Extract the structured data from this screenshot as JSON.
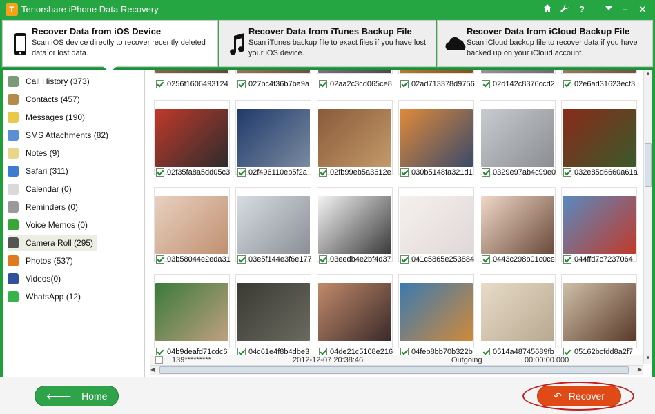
{
  "app": {
    "title": "Tenorshare iPhone Data Recovery",
    "logo_letter": "T"
  },
  "titlebar_buttons": [
    "home-icon",
    "wrench-icon",
    "help-icon",
    "dropdown-icon",
    "minimize-icon",
    "close-icon"
  ],
  "modes": [
    {
      "title": "Recover Data from iOS Device",
      "desc": "Scan iOS device directly to recover recently deleted data or lost data.",
      "icon": "phone-icon",
      "active": true
    },
    {
      "title": "Recover Data from iTunes Backup File",
      "desc": "Scan iTunes backup file to exact files if you have lost your iOS device.",
      "icon": "music-note-icon",
      "active": false
    },
    {
      "title": "Recover Data from iCloud Backup File",
      "desc": "Scan iCloud backup file to recover data if you have backed up on your iCloud account.",
      "icon": "cloud-icon",
      "active": false
    }
  ],
  "sidebar": {
    "items": [
      {
        "label": "Call History (373)",
        "icon": "call-history-icon",
        "color": "#7a9a7a"
      },
      {
        "label": "Contacts (457)",
        "icon": "contacts-icon",
        "color": "#b58a4a"
      },
      {
        "label": "Messages (190)",
        "icon": "messages-icon",
        "color": "#e9c94b"
      },
      {
        "label": "SMS Attachments (82)",
        "icon": "sms-attachments-icon",
        "color": "#5a8fd6"
      },
      {
        "label": "Notes (9)",
        "icon": "notes-icon",
        "color": "#e8d68a"
      },
      {
        "label": "Safari (311)",
        "icon": "safari-icon",
        "color": "#3b7bd1"
      },
      {
        "label": "Calendar (0)",
        "icon": "calendar-icon",
        "color": "#d9d9d9"
      },
      {
        "label": "Reminders (0)",
        "icon": "reminders-icon",
        "color": "#9a9a9a"
      },
      {
        "label": "Voice Memos (0)",
        "icon": "voice-memos-icon",
        "color": "#3aa63a"
      },
      {
        "label": "Camera Roll (295)",
        "icon": "camera-roll-icon",
        "color": "#555555",
        "active": true
      },
      {
        "label": "Photos (537)",
        "icon": "photos-icon",
        "color": "#e07a20"
      },
      {
        "label": "Videos(0)",
        "icon": "videos-icon",
        "color": "#3050a0"
      },
      {
        "label": "WhatsApp (12)",
        "icon": "whatsapp-icon",
        "color": "#36b34a"
      }
    ]
  },
  "gallery": {
    "rows": [
      [
        {
          "name": "0256f1606493124",
          "colors": [
            "#8a6a4a",
            "#5a4a3a"
          ]
        },
        {
          "name": "027bc4f36b7ba9a",
          "colors": [
            "#9a7a5a",
            "#6a5040"
          ]
        },
        {
          "name": "02aa2c3cd065ce8",
          "colors": [
            "#7a7a7a",
            "#4a4a4a"
          ]
        },
        {
          "name": "02ad713378d9756",
          "colors": [
            "#c08030",
            "#805020"
          ]
        },
        {
          "name": "02d142c8376ccd2",
          "colors": [
            "#9a9a9a",
            "#6a6a6a"
          ]
        },
        {
          "name": "02e6ad31623ecf3",
          "colors": [
            "#a08060",
            "#705040"
          ]
        }
      ],
      [
        {
          "name": "02f35fa8a5dd05c3",
          "colors": [
            "#c0392b",
            "#2c2c2c"
          ]
        },
        {
          "name": "02f496110eb5f2a",
          "colors": [
            "#1f3a6a",
            "#7a8aa0"
          ]
        },
        {
          "name": "02fb99eb5a3612e",
          "colors": [
            "#8a5a3a",
            "#c49a6a"
          ]
        },
        {
          "name": "030b5148fa321d1",
          "colors": [
            "#e08a3a",
            "#3a4a6a"
          ]
        },
        {
          "name": "0329e97ab4c99e0",
          "colors": [
            "#c8ccd0",
            "#8a8e92"
          ]
        },
        {
          "name": "032e85d6660a61a",
          "colors": [
            "#8a2a1a",
            "#3a5a2a"
          ]
        }
      ],
      [
        {
          "name": "03b58044e2eda31",
          "colors": [
            "#e8d0c0",
            "#c09070"
          ]
        },
        {
          "name": "03e5f144e3f6e177",
          "colors": [
            "#d8dde3",
            "#8a8f96"
          ]
        },
        {
          "name": "03eedb4e2bf4d37",
          "colors": [
            "#f4f4f4",
            "#3a3a3a"
          ]
        },
        {
          "name": "041c5865e253884",
          "colors": [
            "#f5f0ee",
            "#e0d8d8"
          ]
        },
        {
          "name": "0443c298b01c0ce",
          "colors": [
            "#f0d8c8",
            "#6a4a3a"
          ]
        },
        {
          "name": "044ffd7c7237064",
          "colors": [
            "#5a8ac0",
            "#c03a2a"
          ]
        }
      ],
      [
        {
          "name": "04b9deafd71cdc6",
          "colors": [
            "#3a7a3a",
            "#c0a080"
          ]
        },
        {
          "name": "04c61e4f8b4dbe3",
          "colors": [
            "#3a3a34",
            "#6a6a60"
          ]
        },
        {
          "name": "04de21c5108e216",
          "colors": [
            "#c08a6a",
            "#3a2a2a"
          ]
        },
        {
          "name": "04feb8bb70b322b",
          "colors": [
            "#3a7ab0",
            "#d08a3a"
          ]
        },
        {
          "name": "0514a48745689fb",
          "colors": [
            "#e8dcc8",
            "#b8a890"
          ]
        },
        {
          "name": "05162bcfdd8a2f7",
          "colors": [
            "#d0c0a8",
            "#5a3a2a"
          ]
        }
      ]
    ]
  },
  "list_row": {
    "contact": "139*********",
    "date": "2012-12-07 20:38:46",
    "type": "Outgoing",
    "duration": "00:00:00.000"
  },
  "footer": {
    "home_label": "Home",
    "recover_label": "Recover"
  }
}
